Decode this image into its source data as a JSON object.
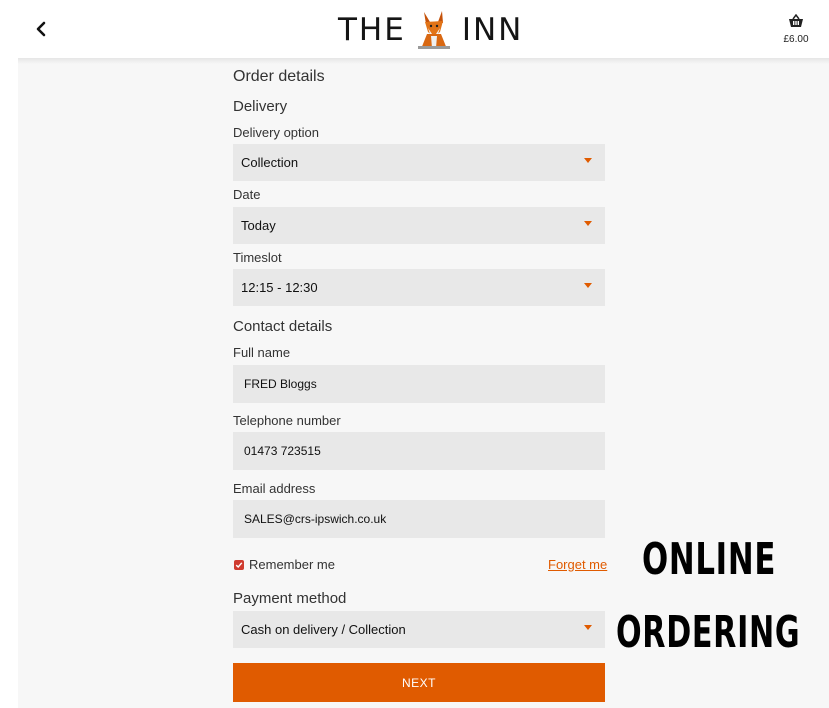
{
  "header": {
    "logo_left": "THE",
    "logo_right": "INN",
    "logo_image": "fox-logo",
    "basket_icon": "basket-icon",
    "back_icon": "chevron-left-icon",
    "basket_total": "£6.00"
  },
  "form": {
    "title": "Order details",
    "delivery_section": "Delivery",
    "delivery_option_label": "Delivery option",
    "delivery_option_value": "Collection",
    "date_label": "Date",
    "date_value": "Today",
    "timeslot_label": "Timeslot",
    "timeslot_value": "12:15 - 12:30",
    "contact_section": "Contact details",
    "fullname_label": "Full name",
    "fullname_value": "FRED Bloggs",
    "phone_label": "Telephone number",
    "phone_value": "01473 723515",
    "email_label": "Email address",
    "email_value": "SALES@crs-ipswich.co.uk",
    "remember_label": "Remember me",
    "remember_checked": true,
    "forget_label": "Forget me",
    "payment_section": "Payment method",
    "payment_value": "Cash on delivery / Collection",
    "next_label": "NEXT"
  },
  "promo": {
    "line1": "ONLINE",
    "line2": "ORDERING"
  },
  "colors": {
    "accent": "#e05b00",
    "checkbox": "#cf3b2f",
    "field_bg": "#e8e8e8",
    "page_bg": "#f7f7f7"
  }
}
